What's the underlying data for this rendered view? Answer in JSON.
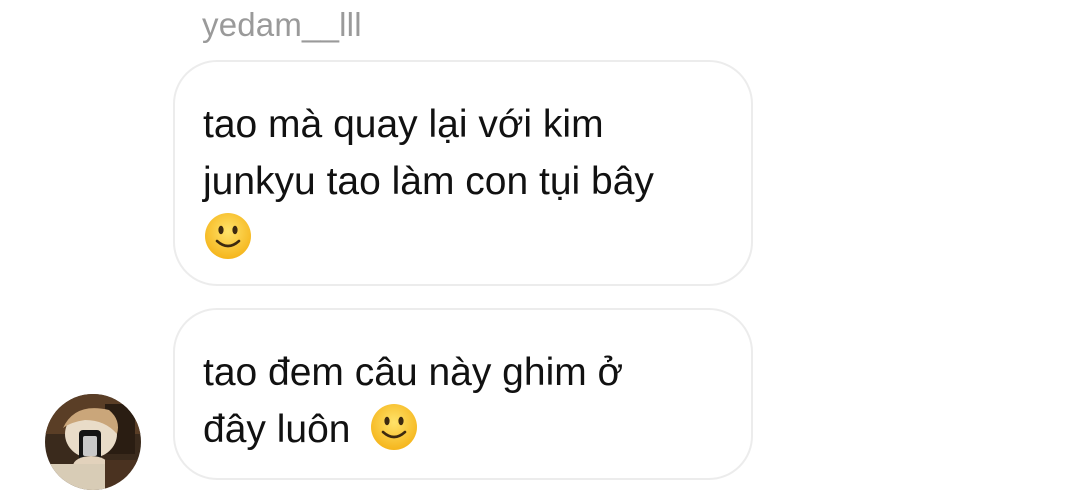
{
  "thread": {
    "sender_name": "yedam__lll",
    "avatar_icon": "user-avatar-photo",
    "messages": [
      {
        "lines": [
          "tao mà quay lại với kim",
          "junkyu tao làm con tụi bây"
        ],
        "emoji": "slightly-smiling-face"
      },
      {
        "lines": [
          "tao đem câu này ghim ở",
          "đây luôn"
        ],
        "emoji": "slightly-smiling-face"
      }
    ]
  }
}
